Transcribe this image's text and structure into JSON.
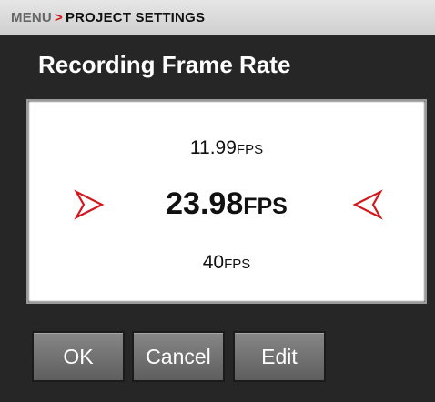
{
  "breadcrumb": {
    "root": "MENU",
    "separator": ">",
    "current": "PROJECT SETTINGS"
  },
  "title": "Recording Frame Rate",
  "selector": {
    "previous": {
      "value": "11.99",
      "unit": "FPS"
    },
    "current": {
      "value": "23.98",
      "unit": "FPS"
    },
    "next": {
      "value": "40",
      "unit": "FPS"
    }
  },
  "icons": {
    "left_arrow": "arrow-right-outline-icon",
    "right_arrow": "arrow-left-outline-icon"
  },
  "colors": {
    "accent": "#d4171c",
    "background": "#262626",
    "panel": "#ffffff",
    "button": "#707070"
  },
  "buttons": {
    "ok": "OK",
    "cancel": "Cancel",
    "edit": "Edit"
  }
}
